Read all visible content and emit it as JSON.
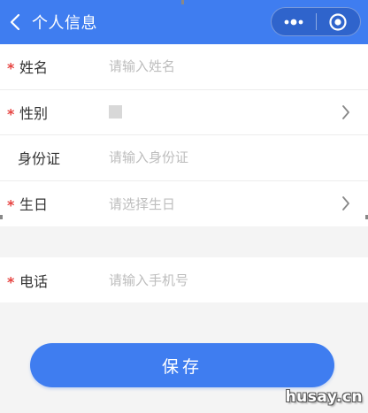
{
  "header": {
    "title": "个人信息",
    "back_icon": "chevron-left-icon",
    "more_icon": "more-dots-icon",
    "close_icon": "target-circle-icon",
    "bg_color": "#3f7df0"
  },
  "form": {
    "required_mark": "*",
    "name": {
      "label": "姓名",
      "placeholder": "请输入姓名",
      "required": true
    },
    "gender": {
      "label": "性别",
      "required": true
    },
    "id_card": {
      "label": "身份证",
      "placeholder": "请输入身份证",
      "required": false
    },
    "birthday": {
      "label": "生日",
      "placeholder": "请选择生日",
      "required": true
    },
    "phone": {
      "label": "电话",
      "placeholder": "请输入手机号",
      "required": true
    }
  },
  "save_button": {
    "label": "保存"
  },
  "watermark": "husay.cn",
  "colors": {
    "accent": "#3f7df0",
    "required": "#e64340",
    "placeholder": "#bdbdbd"
  }
}
